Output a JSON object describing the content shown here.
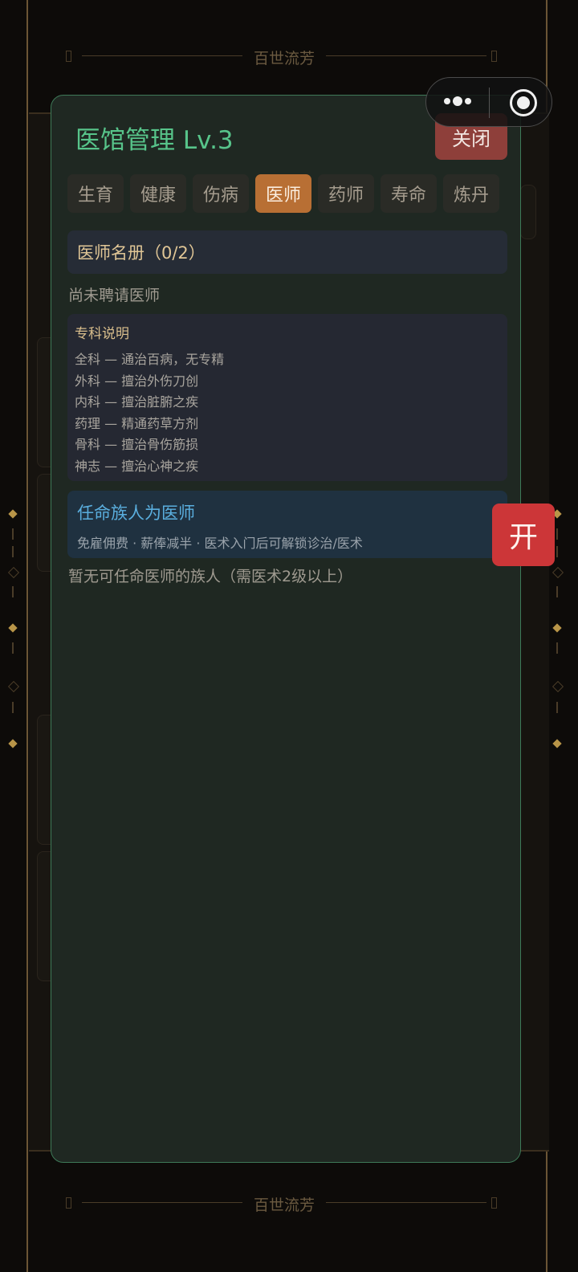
{
  "app_banner": "百世流芳",
  "modal": {
    "title": "医馆管理 Lv.3",
    "close_label": "关闭",
    "tabs": [
      {
        "label": "生育"
      },
      {
        "label": "健康"
      },
      {
        "label": "伤病"
      },
      {
        "label": "医师",
        "active": true
      },
      {
        "label": "药师"
      },
      {
        "label": "寿命"
      },
      {
        "label": "炼丹"
      }
    ],
    "roster_header": "医师名册（0/2）",
    "roster_empty": "尚未聘请医师",
    "specialty": {
      "title": "专科说明",
      "lines": [
        "全科 — 通治百病，无专精",
        "外科 — 擅治外伤刀创",
        "内科 — 擅治脏腑之疾",
        "药理 — 精通药草方剂",
        "骨科 — 擅治骨伤筋损",
        "神志 — 擅治心神之疾"
      ]
    },
    "appoint": {
      "title": "任命族人为医师",
      "subtitle": "免雇佣费 · 薪俸减半 · 医术入门后可解锁诊治/医术"
    },
    "appoint_empty": "暂无可任命医师的族人（需医术2级以上）"
  },
  "floating_button": "开",
  "colors": {
    "modal_border": "#3e7a58",
    "title_green": "#57c48a",
    "tab_active": "#b86f34",
    "close_red": "#8e3f3a",
    "appoint_blue": "#5aaede",
    "float_red": "#cc3638"
  },
  "icons": [
    "more-dots-icon",
    "capsule-close-icon"
  ]
}
